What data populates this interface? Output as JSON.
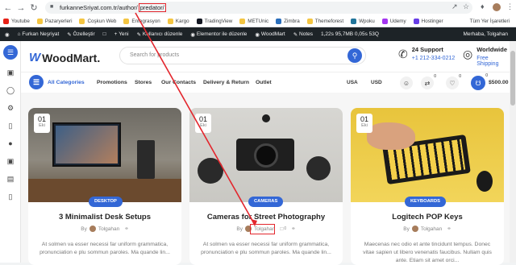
{
  "browser": {
    "url_base": "furkanneSriyat.com.tr/author/",
    "url_path": "predator/",
    "bookmarks": [
      "Youtube",
      "Pazaryerleri",
      "Coşkun Web",
      "Entegrasyon",
      "Kargo",
      "TradingView",
      "METUnic",
      "Zimbra",
      "Themeforest",
      "Wpoku",
      "Udemy",
      "Hostinger"
    ],
    "bookmarks_right": "Tüm Yer İşaretleri"
  },
  "wp_admin": {
    "site": "Furkan Neşriyat",
    "customize": "Özelleştir",
    "new": "Yeni",
    "edit_user": "Kullanıcı düzenle",
    "elementor": "Elementor ile düzenle",
    "woodmart": "WoodMart",
    "notes": "Notes",
    "perf": "1,22s 95,7MB 0,05s 53Q",
    "greeting": "Merhaba, Tolgahan"
  },
  "header": {
    "logo": "WoodMart.",
    "search_placeholder": "Search for products",
    "support_title": "24 Support",
    "support_phone": "+1 212-334-0212",
    "shipping_title": "Worldwide",
    "shipping_sub": "Free Shipping"
  },
  "nav": {
    "all_categories": "All Categories",
    "links": [
      "Promotions",
      "Stores",
      "Our Contacts",
      "Delivery & Return",
      "Outlet"
    ],
    "lang": "USA",
    "currency": "USD",
    "compare_count": "0",
    "wishlist_count": "0",
    "cart_count": "0",
    "cart_total": "$500.00"
  },
  "posts": [
    {
      "day": "01",
      "month": "Eki",
      "category": "DESKTOP",
      "title": "3 Minimalist Desk Setups",
      "by": "By",
      "author": "Tolgahan",
      "excerpt": "At solmen va esser necessi far uniform grammatica, pronunciation e plu sommun paroles. Ma quande lin..."
    },
    {
      "day": "01",
      "month": "Eki",
      "category": "CAMERAS",
      "title": "Cameras for Street Photography",
      "by": "By",
      "author": "Tolgahan",
      "comments": "0",
      "excerpt": "At solmen va esser necessi far uniform grammatica, pronunciation e plu sommun paroles. Ma quande lin..."
    },
    {
      "day": "01",
      "month": "Eki",
      "category": "KEYBOARDS",
      "title": "Logitech POP Keys",
      "by": "By",
      "author": "Tolgahan",
      "excerpt": "Maecenas nec odio et ante tincidunt tempus. Donec vitae sapien ut libero venenatis faucibus. Nullam quis ante. Etiam sit amet orci..."
    }
  ],
  "colors": {
    "accent": "#3367d6",
    "annotation": "#e3262d",
    "wp_bar": "#1d2327"
  }
}
